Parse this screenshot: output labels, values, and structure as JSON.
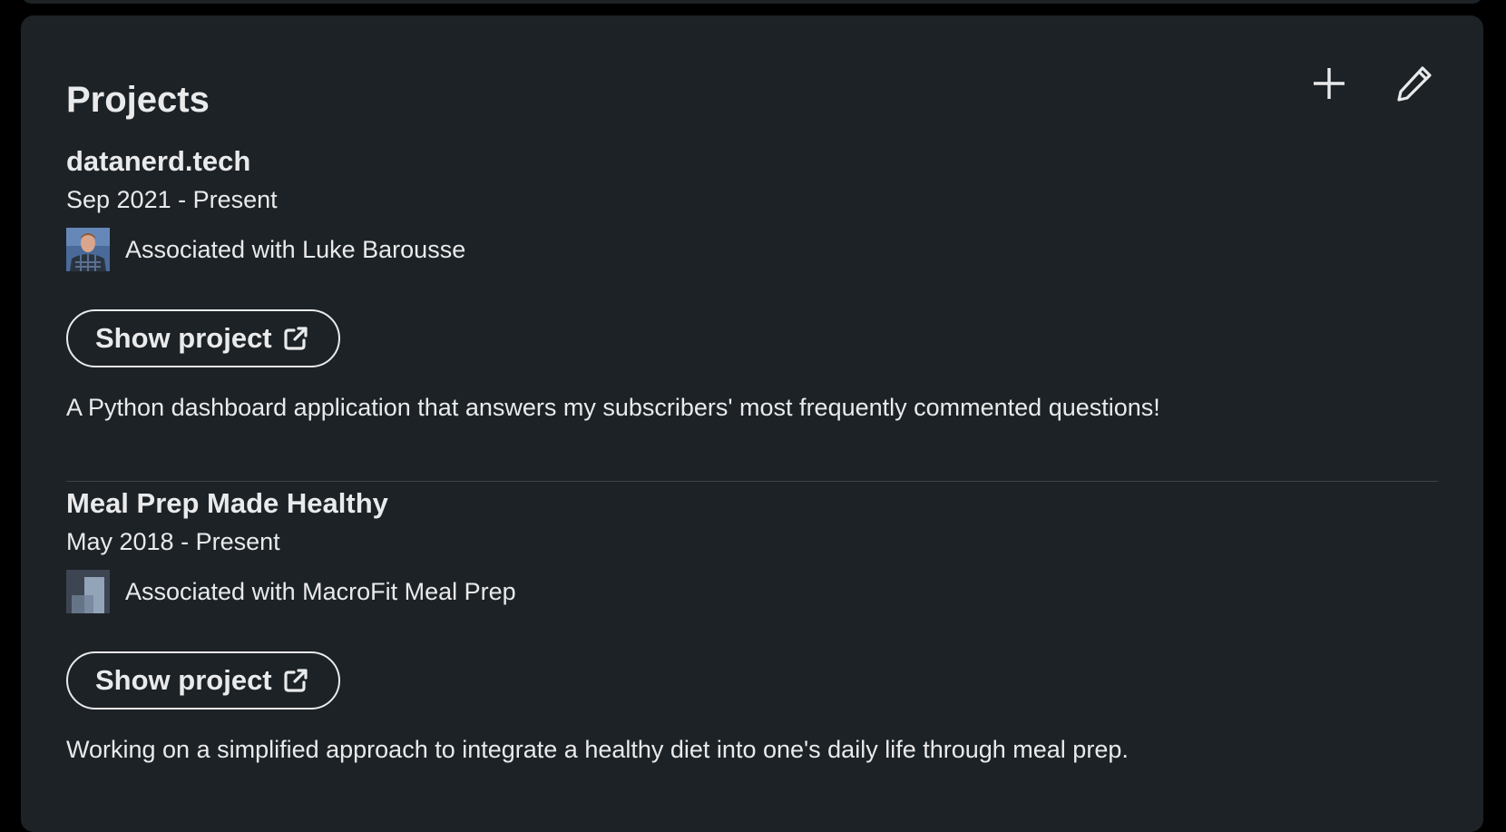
{
  "section": {
    "title": "Projects",
    "actions": [
      {
        "name": "add",
        "icon": "plus-icon"
      },
      {
        "name": "edit",
        "icon": "pencil-icon"
      }
    ]
  },
  "projects": [
    {
      "title": "datanerd.tech",
      "dates": "Sep 2021 - Present",
      "associated": "Associated with Luke Barousse",
      "associated_logo": "profile-photo",
      "button_label": "Show project",
      "button_icon": "external-link-icon",
      "description": "A Python dashboard application that answers my subscribers' most frequently commented questions!"
    },
    {
      "title": "Meal Prep Made Healthy",
      "dates": "May 2018 - Present",
      "associated": "Associated with MacroFit Meal Prep",
      "associated_logo": "company-placeholder-logo",
      "button_label": "Show project",
      "button_icon": "external-link-icon",
      "description": "Working on a simplified approach to integrate a healthy diet into one's daily life through meal prep."
    }
  ],
  "colors": {
    "page_background": "#000000",
    "card_background": "#1d2226",
    "text": "#e9eaeb",
    "divider": "#3e4347"
  }
}
